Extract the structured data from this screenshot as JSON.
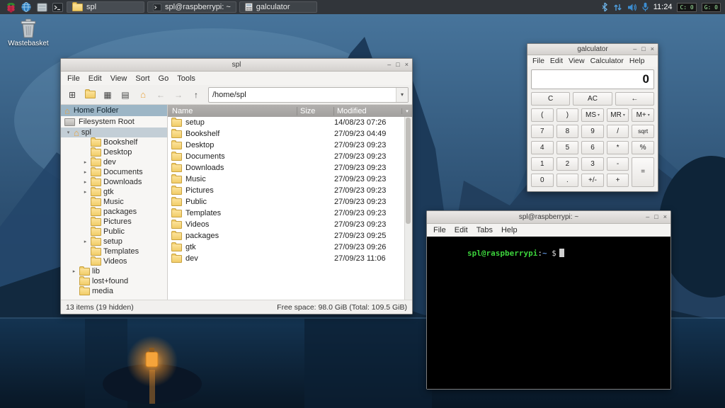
{
  "icons": {
    "minimize": "–",
    "maximize": "□",
    "close": "×",
    "dropdown": "▾",
    "expander_open": "▾",
    "expander_closed": "▸",
    "back": "←",
    "forward": "→",
    "up": "↑",
    "home": "⌂",
    "new_window": "⊞",
    "icon_view": "▦",
    "list_view": "▤",
    "terminal_glyph": ">_"
  },
  "taskbar": {
    "tasks": [
      {
        "label": "spl"
      },
      {
        "label": "spl@raspberrypi: ~"
      },
      {
        "label": "galculator"
      }
    ],
    "tray": {
      "time": "11:24",
      "cpu_label": "C: 0",
      "gpu_label": "G: 0"
    }
  },
  "desktop": {
    "wastebasket_label": "Wastebasket"
  },
  "file_manager": {
    "title": "spl",
    "menu": [
      "File",
      "Edit",
      "View",
      "Sort",
      "Go",
      "Tools"
    ],
    "path": "/home/spl",
    "places": [
      {
        "label": "Home Folder"
      },
      {
        "label": "Filesystem Root"
      }
    ],
    "tree": [
      {
        "label": "spl"
      },
      {
        "label": "Bookshelf"
      },
      {
        "label": "Desktop"
      },
      {
        "label": "dev"
      },
      {
        "label": "Documents"
      },
      {
        "label": "Downloads"
      },
      {
        "label": "gtk"
      },
      {
        "label": "Music"
      },
      {
        "label": "packages"
      },
      {
        "label": "Pictures"
      },
      {
        "label": "Public"
      },
      {
        "label": "setup"
      },
      {
        "label": "Templates"
      },
      {
        "label": "Videos"
      },
      {
        "label": "lib"
      },
      {
        "label": "lost+found"
      },
      {
        "label": "media"
      }
    ],
    "columns": {
      "name": "Name",
      "size": "Size",
      "modified": "Modified"
    },
    "files": [
      {
        "name": "setup",
        "modified": "14/08/23 07:26"
      },
      {
        "name": "Bookshelf",
        "modified": "27/09/23 04:49"
      },
      {
        "name": "Desktop",
        "modified": "27/09/23 09:23"
      },
      {
        "name": "Documents",
        "modified": "27/09/23 09:23"
      },
      {
        "name": "Downloads",
        "modified": "27/09/23 09:23"
      },
      {
        "name": "Music",
        "modified": "27/09/23 09:23"
      },
      {
        "name": "Pictures",
        "modified": "27/09/23 09:23"
      },
      {
        "name": "Public",
        "modified": "27/09/23 09:23"
      },
      {
        "name": "Templates",
        "modified": "27/09/23 09:23"
      },
      {
        "name": "Videos",
        "modified": "27/09/23 09:23"
      },
      {
        "name": "packages",
        "modified": "27/09/23 09:25"
      },
      {
        "name": "gtk",
        "modified": "27/09/23 09:26"
      },
      {
        "name": "dev",
        "modified": "27/09/23 11:06"
      }
    ],
    "status_left": "13 items (19 hidden)",
    "status_right": "Free space: 98.0 GiB (Total: 109.5 GiB)"
  },
  "calculator": {
    "title": "galculator",
    "menu": [
      "File",
      "Edit",
      "View",
      "Calculator",
      "Help"
    ],
    "display": "0",
    "buttons": {
      "clear_row": [
        "C",
        "AC",
        "←"
      ],
      "row2": [
        "(",
        ")",
        "MS",
        "MR",
        "M+"
      ],
      "row3": [
        "7",
        "8",
        "9",
        "/",
        "sqrt"
      ],
      "row4": [
        "4",
        "5",
        "6",
        "*",
        "%"
      ],
      "row5": [
        "1",
        "2",
        "3",
        "-"
      ],
      "row6": [
        "0",
        ".",
        "+/-",
        "+"
      ],
      "equals": "="
    }
  },
  "terminal": {
    "title": "spl@raspberrypi: ~",
    "menu": [
      "File",
      "Edit",
      "Tabs",
      "Help"
    ],
    "prompt_user": "spl@raspberrypi",
    "prompt_colon": ":",
    "prompt_path": "~",
    "prompt_symbol": "$"
  }
}
